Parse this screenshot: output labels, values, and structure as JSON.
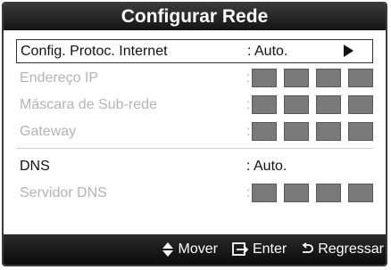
{
  "dialog": {
    "title": "Configurar Rede"
  },
  "rows": [
    {
      "label": "Config. Protoc. Internet",
      "value": ": Auto."
    },
    {
      "label": "Endereço IP",
      "value": ":"
    },
    {
      "label": "Máscara de Sub-rede",
      "value": ":"
    },
    {
      "label": "Gateway",
      "value": ":"
    },
    {
      "label": "DNS",
      "value": ": Auto."
    },
    {
      "label": "Servidor DNS",
      "value": ":"
    }
  ],
  "footer": {
    "move_label": "Mover",
    "enter_label": "Enter",
    "return_label": "Regressar"
  },
  "icons": {
    "selector_arrow": "arrow-right-icon",
    "move": "up-down-icon",
    "enter": "enter-icon",
    "return": "return-icon"
  },
  "colors": {
    "titlebar": "#1a1a1a",
    "disabled_text": "#b4b4b4",
    "octet_box": "#7a7a7a"
  }
}
